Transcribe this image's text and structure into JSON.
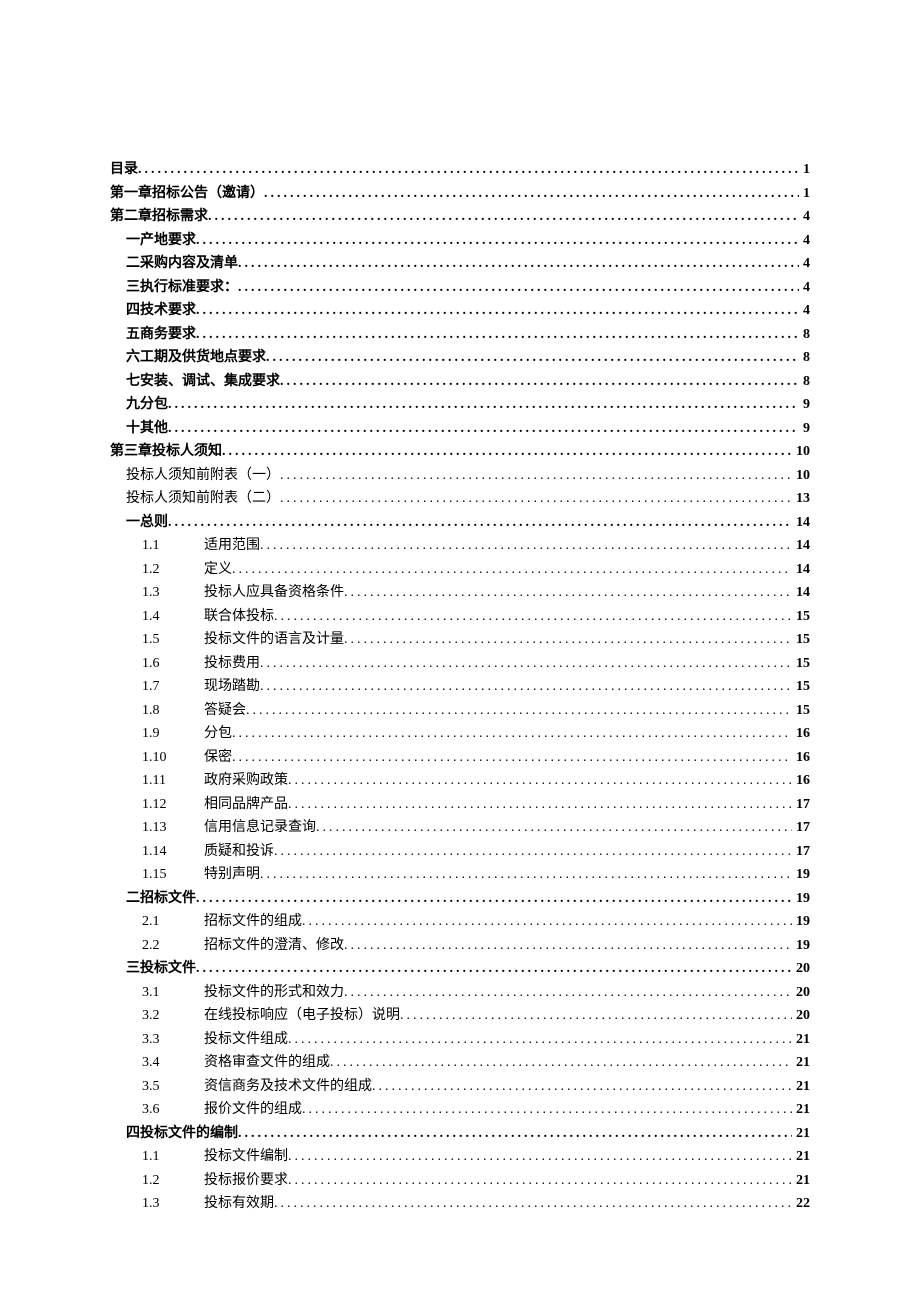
{
  "toc": [
    {
      "level": 0,
      "num": "",
      "title": "目录",
      "page": "1",
      "bold": true
    },
    {
      "level": 0,
      "num": "",
      "title": "第一章招标公告（邀请）",
      "page": "1",
      "bold": true
    },
    {
      "level": 0,
      "num": "",
      "title": "第二章招标需求",
      "page": "4",
      "bold": true
    },
    {
      "level": 1,
      "num": "",
      "title": "一产地要求",
      "page": "4",
      "bold": true
    },
    {
      "level": 1,
      "num": "",
      "title": "二采购内容及清单",
      "page": "4",
      "bold": true
    },
    {
      "level": 1,
      "num": "",
      "title": "三执行标准要求：",
      "page": "4",
      "bold": true
    },
    {
      "level": 1,
      "num": "",
      "title": "四技术要求",
      "page": "4",
      "bold": true
    },
    {
      "level": 1,
      "num": "",
      "title": "五商务要求",
      "page": "8",
      "bold": true
    },
    {
      "level": 1,
      "num": "",
      "title": "六工期及供货地点要求",
      "page": "8",
      "bold": true
    },
    {
      "level": 1,
      "num": "",
      "title": "七安装、调试、集成要求",
      "page": "8",
      "bold": true
    },
    {
      "level": 1,
      "num": "",
      "title": "九分包",
      "page": "9",
      "bold": true
    },
    {
      "level": 1,
      "num": "",
      "title": "十其他",
      "page": "9",
      "bold": true
    },
    {
      "level": 0,
      "num": "",
      "title": "第三章投标人须知",
      "page": "10",
      "bold": true
    },
    {
      "level": 1,
      "num": "",
      "title": "投标人须知前附表（一）",
      "page": "10",
      "bold": false
    },
    {
      "level": 1,
      "num": "",
      "title": "投标人须知前附表（二）",
      "page": "13",
      "bold": false
    },
    {
      "level": 1,
      "num": "",
      "title": "一总则",
      "page": "14",
      "bold": true
    },
    {
      "level": 3,
      "num": "1.1",
      "title": "适用范围",
      "page": "14",
      "bold": false
    },
    {
      "level": 3,
      "num": "1.2",
      "title": "定义",
      "page": "14",
      "bold": false
    },
    {
      "level": 3,
      "num": "1.3",
      "title": "投标人应具备资格条件",
      "page": "14",
      "bold": false
    },
    {
      "level": 3,
      "num": "1.4",
      "title": "联合体投标",
      "page": "15",
      "bold": false
    },
    {
      "level": 3,
      "num": "1.5",
      "title": "投标文件的语言及计量",
      "page": "15",
      "bold": false
    },
    {
      "level": 3,
      "num": "1.6",
      "title": "投标费用",
      "page": "15",
      "bold": false
    },
    {
      "level": 3,
      "num": "1.7",
      "title": "现场踏勘",
      "page": "15",
      "bold": false
    },
    {
      "level": 3,
      "num": "1.8",
      "title": "答疑会",
      "page": "15",
      "bold": false
    },
    {
      "level": 3,
      "num": "1.9",
      "title": "分包",
      "page": "16",
      "bold": false
    },
    {
      "level": 3,
      "num": "1.10",
      "title": "保密",
      "page": "16",
      "bold": false
    },
    {
      "level": 3,
      "num": "1.11",
      "title": "政府采购政策",
      "page": "16",
      "bold": false
    },
    {
      "level": 3,
      "num": "1.12",
      "title": "相同品牌产品",
      "page": "17",
      "bold": false
    },
    {
      "level": 3,
      "num": "1.13",
      "title": "信用信息记录查询",
      "page": "17",
      "bold": false
    },
    {
      "level": 3,
      "num": "1.14",
      "title": "质疑和投诉",
      "page": "17",
      "bold": false
    },
    {
      "level": 3,
      "num": "1.15",
      "title": "特别声明",
      "page": "19",
      "bold": false
    },
    {
      "level": 1,
      "num": "",
      "title": "二招标文件",
      "page": "19",
      "bold": true
    },
    {
      "level": 3,
      "num": "2.1",
      "title": "招标文件的组成",
      "page": "19",
      "bold": false
    },
    {
      "level": 3,
      "num": "2.2",
      "title": "招标文件的澄清、修改",
      "page": "19",
      "bold": false
    },
    {
      "level": 1,
      "num": "",
      "title": "三投标文件",
      "page": "20",
      "bold": true
    },
    {
      "level": 3,
      "num": "3.1",
      "title": "投标文件的形式和效力",
      "page": "20",
      "bold": false
    },
    {
      "level": 3,
      "num": "3.2",
      "title": "在线投标响应（电子投标）说明",
      "page": "20",
      "bold": false
    },
    {
      "level": 3,
      "num": "3.3",
      "title": "投标文件组成",
      "page": "21",
      "bold": false
    },
    {
      "level": 3,
      "num": "3.4",
      "title": "资格审查文件的组成",
      "page": "21",
      "bold": false
    },
    {
      "level": 3,
      "num": "3.5",
      "title": "资信商务及技术文件的组成",
      "page": "21",
      "bold": false
    },
    {
      "level": 3,
      "num": "3.6",
      "title": "报价文件的组成",
      "page": "21",
      "bold": false
    },
    {
      "level": 1,
      "num": "",
      "title": "四投标文件的编制",
      "page": "21",
      "bold": true
    },
    {
      "level": 3,
      "num": "1.1",
      "title": "投标文件编制",
      "page": "21",
      "bold": false
    },
    {
      "level": 3,
      "num": "1.2",
      "title": "投标报价要求",
      "page": "21",
      "bold": false
    },
    {
      "level": 3,
      "num": "1.3",
      "title": "投标有效期",
      "page": "22",
      "bold": false
    }
  ]
}
